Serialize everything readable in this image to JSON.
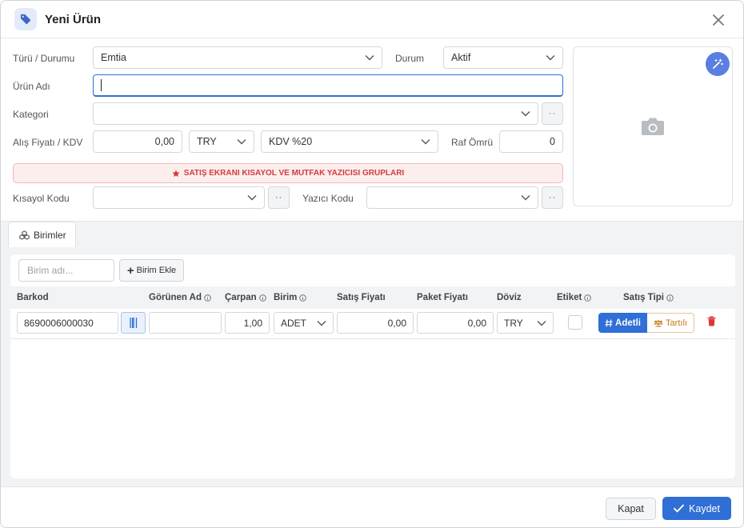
{
  "header": {
    "title": "Yeni Ürün",
    "tag_icon": "tag-icon",
    "close_icon": "close-icon"
  },
  "form": {
    "type_status_label": "Türü / Durumu",
    "type_value": "Emtia",
    "status_label": "Durum",
    "status_value": "Aktif",
    "name_label": "Ürün Adı",
    "name_value": "",
    "category_label": "Kategori",
    "category_value": "",
    "purchase_label": "Alış Fiyatı / KDV",
    "purchase_price": "0,00",
    "currency_value": "TRY",
    "vat_value": "KDV %20",
    "shelf_life_label": "Raf Ömrü",
    "shelf_life_value": "0",
    "dots_label": "··",
    "banner_text": "SATIŞ EKRANI KISAYOL VE MUTFAK YAZICISI GRUPLARI",
    "shortcut_label": "Kısayol Kodu",
    "shortcut_value": "",
    "printer_label": "Yazıcı Kodu",
    "printer_value": ""
  },
  "photo": {
    "magic_icon": "magic-wand-icon",
    "camera_icon": "camera-icon"
  },
  "tabs": [
    {
      "label": "Birimler",
      "icon": "cubes-icon"
    }
  ],
  "units": {
    "input_placeholder": "Birim adı...",
    "add_label": "Birim Ekle",
    "columns": [
      "Barkod",
      "Görünen Ad",
      "Çarpan",
      "Birim",
      "Satış Fiyatı",
      "Paket Fiyatı",
      "Döviz",
      "Etiket",
      "Satış Tipi"
    ],
    "rows": [
      {
        "barcode": "8690006000030",
        "display_name": "",
        "multiplier": "1,00",
        "unit": "ADET",
        "sale_price": "0,00",
        "package_price": "0,00",
        "currency": "TRY",
        "label_checked": false,
        "sale_type_a": "Adetli",
        "sale_type_b": "Tartılı"
      }
    ]
  },
  "footer": {
    "close_label": "Kapat",
    "save_label": "Kaydet"
  },
  "colors": {
    "accent": "#2f6fd6",
    "danger": "#d33b3b",
    "banner_bg": "#fdeeee",
    "weighed": "#c47a12"
  }
}
